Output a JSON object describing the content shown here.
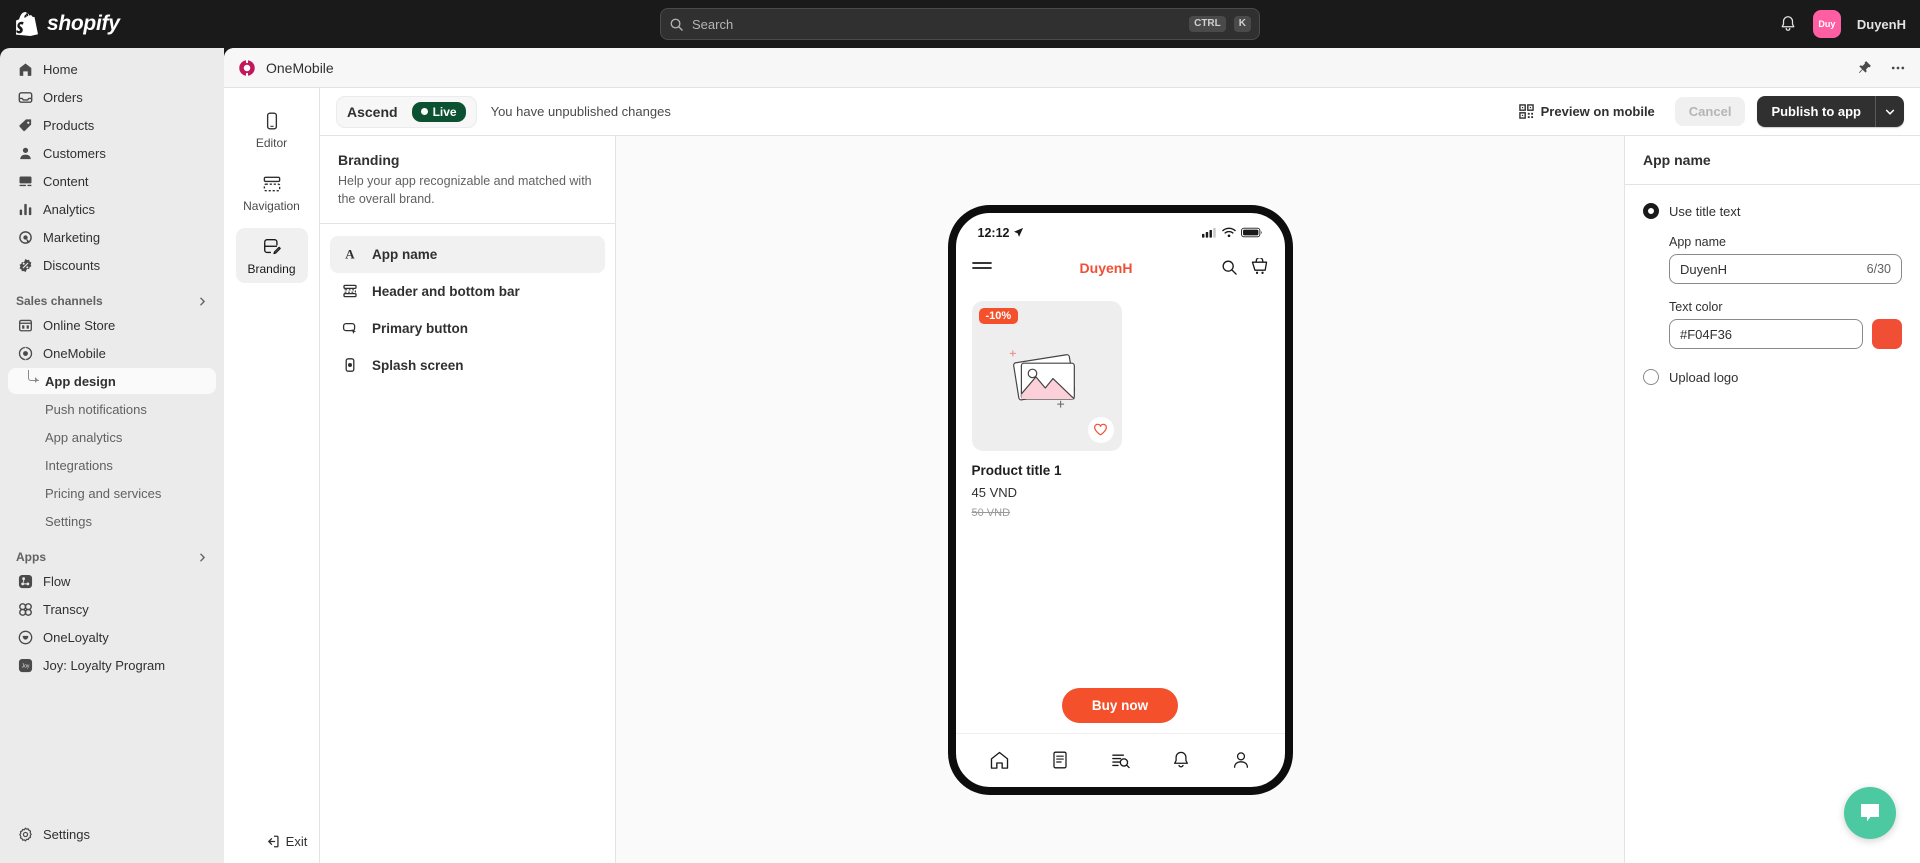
{
  "topbar": {
    "brand": "shopify",
    "search": {
      "placeholder": "Search",
      "shortcut_ctrl": "CTRL",
      "shortcut_key": "K"
    },
    "account": {
      "initials": "Duy",
      "name": "DuyenH"
    }
  },
  "sidebar": {
    "primary": [
      {
        "label": "Home",
        "icon": "home-icon"
      },
      {
        "label": "Orders",
        "icon": "orders-icon"
      },
      {
        "label": "Products",
        "icon": "products-tag-icon"
      },
      {
        "label": "Customers",
        "icon": "customers-icon"
      },
      {
        "label": "Content",
        "icon": "content-icon"
      },
      {
        "label": "Analytics",
        "icon": "analytics-bars-icon"
      },
      {
        "label": "Marketing",
        "icon": "marketing-target-icon"
      },
      {
        "label": "Discounts",
        "icon": "discounts-icon"
      }
    ],
    "sales_channels_header": "Sales channels",
    "sales_channels": [
      {
        "label": "Online Store",
        "icon": "online-store-icon"
      },
      {
        "label": "OneMobile",
        "icon": "onemobile-icon"
      }
    ],
    "onemobile_sub": [
      {
        "label": "App design",
        "active": true
      },
      {
        "label": "Push notifications",
        "active": false
      },
      {
        "label": "App analytics",
        "active": false
      },
      {
        "label": "Integrations",
        "active": false
      },
      {
        "label": "Pricing and services",
        "active": false
      },
      {
        "label": "Settings",
        "active": false
      }
    ],
    "apps_header": "Apps",
    "apps": [
      {
        "label": "Flow",
        "icon": "flow-icon"
      },
      {
        "label": "Transcy",
        "icon": "transcy-icon"
      },
      {
        "label": "OneLoyalty",
        "icon": "oneloyalty-icon"
      },
      {
        "label": "Joy: Loyalty Program",
        "icon": "joy-icon"
      }
    ],
    "settings_label": "Settings"
  },
  "app_header": {
    "title": "OneMobile",
    "pin_icon": "pin-icon",
    "more_icon": "more-horizontal-icon"
  },
  "toolbar": {
    "theme_name": "Ascend",
    "live_label": "Live",
    "unpublished_text": "You have unpublished changes",
    "preview_label": "Preview on mobile",
    "cancel_label": "Cancel",
    "publish_label": "Publish to app"
  },
  "rail": [
    {
      "label": "Editor",
      "icon": "mobile-device-icon",
      "active": false
    },
    {
      "label": "Navigation",
      "icon": "navigation-layout-icon",
      "active": false
    },
    {
      "label": "Branding",
      "icon": "branding-icon",
      "active": true
    }
  ],
  "exit_label": "Exit",
  "settings_pane": {
    "title": "Branding",
    "description": "Help your app recognizable and matched with the overall brand.",
    "items": [
      {
        "label": "App name",
        "icon": "letter-a-icon",
        "active": true
      },
      {
        "label": "Header and bottom bar",
        "icon": "header-bottom-bar-icon",
        "active": false
      },
      {
        "label": "Primary button",
        "icon": "primary-button-icon",
        "active": false
      },
      {
        "label": "Splash screen",
        "icon": "splash-screen-icon",
        "active": false
      }
    ]
  },
  "preview": {
    "status_time": "12:12",
    "app_title": "DuyenH",
    "app_title_color": "#F04F36",
    "product": {
      "discount_badge": "-10%",
      "title": "Product title 1",
      "price": "45 VND",
      "compare_at_price": "50 VND"
    },
    "buy_button": "Buy now",
    "tabs": [
      {
        "icon": "home-outline-icon"
      },
      {
        "icon": "catalog-icon"
      },
      {
        "icon": "search-list-icon"
      },
      {
        "icon": "bell-icon"
      },
      {
        "icon": "person-icon"
      }
    ]
  },
  "inspector": {
    "title": "App name",
    "option_title_text": "Use title text",
    "option_upload_logo": "Upload logo",
    "app_name_label": "App name",
    "app_name_value": "DuyenH",
    "app_name_counter": "6/30",
    "text_color_label": "Text color",
    "text_color_value": "#F04F36",
    "swatch_color": "#F04F36"
  },
  "chat": {
    "icon": "chat-bubble-icon",
    "color": "#4CC9A0"
  }
}
